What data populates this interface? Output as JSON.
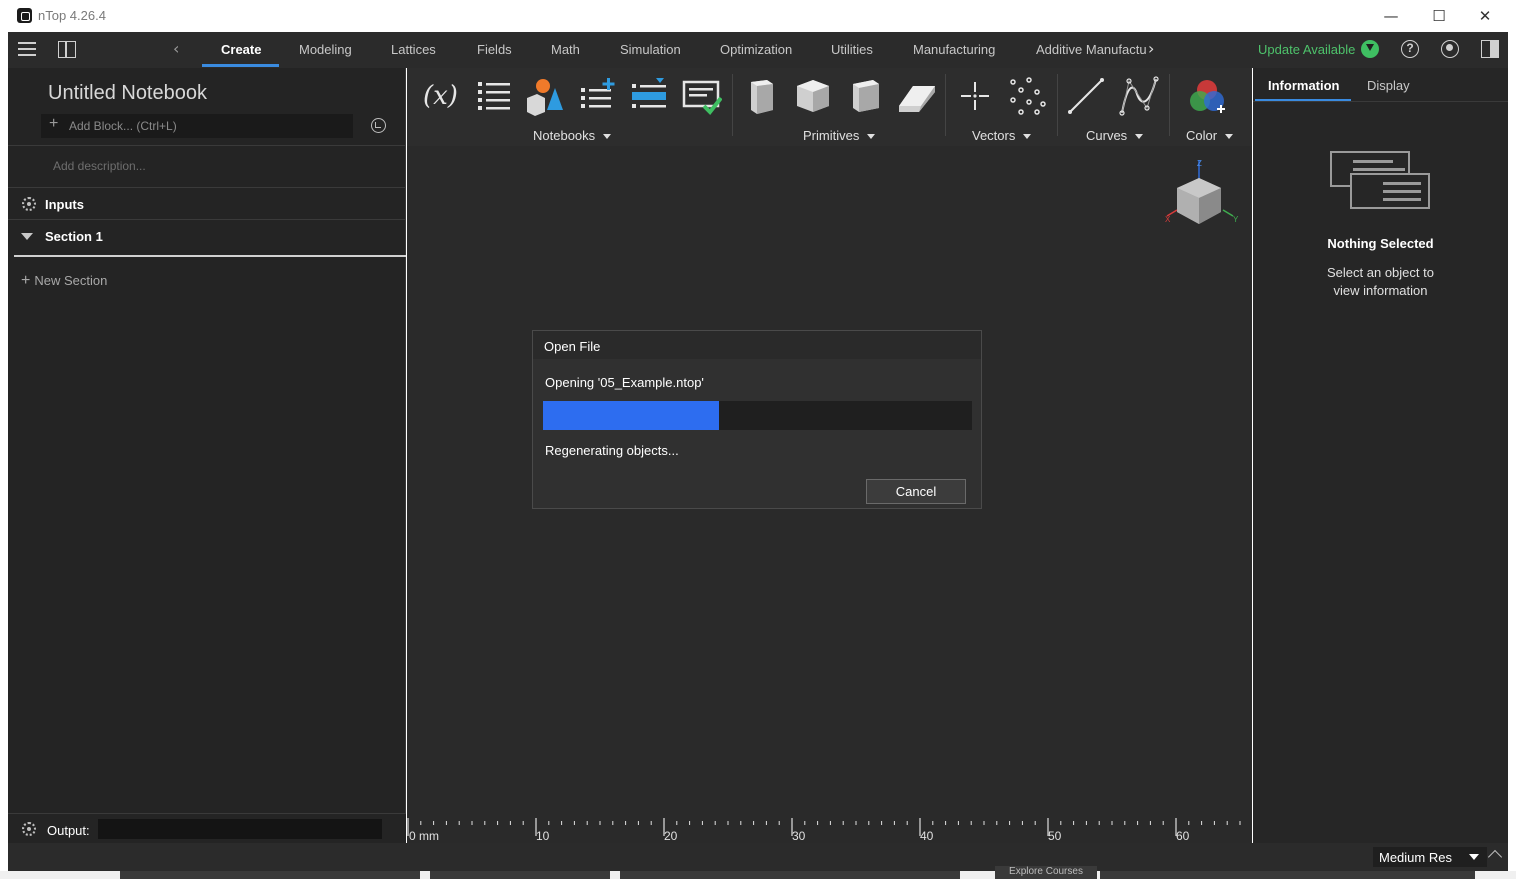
{
  "window": {
    "title": "nTop 4.26.4",
    "controls": {
      "minimize": "—",
      "maximize": "☐",
      "close": "✕"
    }
  },
  "ribbon_tabs": {
    "items": [
      "Create",
      "Modeling",
      "Lattices",
      "Fields",
      "Math",
      "Simulation",
      "Optimization",
      "Utilities",
      "Manufacturing",
      "Additive Manufactu"
    ],
    "active": "Create",
    "update_label": "Update Available"
  },
  "toolbar_groups": {
    "notebooks": "Notebooks",
    "primitives": "Primitives",
    "vectors": "Vectors",
    "curves": "Curves",
    "color": "Color",
    "variable_icon": "(x)"
  },
  "notebook": {
    "title": "Untitled Notebook",
    "add_block_placeholder": "Add Block... (Ctrl+L)",
    "add_description_placeholder": "Add description...",
    "inputs_label": "Inputs",
    "section_label": "Section 1",
    "new_section_label": "New Section",
    "output_label": "Output:"
  },
  "viewport": {
    "ruler_labels": [
      "0 mm",
      "10",
      "20",
      "30",
      "40",
      "50",
      "60"
    ]
  },
  "dialog": {
    "title": "Open File",
    "opening_text": "Opening '05_Example.ntop'",
    "progress": 0.41,
    "status_text": "Regenerating objects...",
    "cancel_label": "Cancel",
    "progress_color": "#2d6df0"
  },
  "properties": {
    "tabs": [
      "Information",
      "Display"
    ],
    "active_tab": "Information",
    "empty_title": "Nothing Selected",
    "empty_text": "Select an object to view information"
  },
  "statusbar": {
    "resolution": "Medium Res"
  },
  "background": {
    "explore_label": "Explore Courses"
  },
  "colors": {
    "accent": "#3a8be0",
    "update_green": "#4ec26b",
    "panel_bg": "#242424",
    "viewport_bg": "#2a2a2a"
  }
}
